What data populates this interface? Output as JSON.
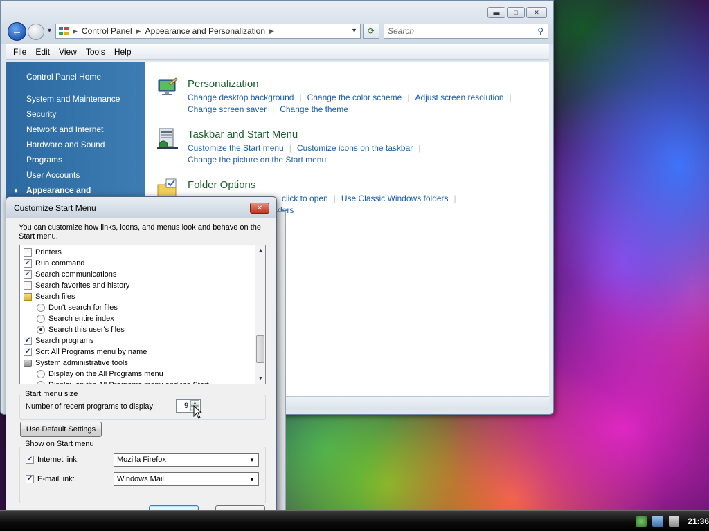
{
  "control_panel": {
    "address": [
      "Control Panel",
      "Appearance and Personalization"
    ],
    "search_placeholder": "Search",
    "menu": [
      "File",
      "Edit",
      "View",
      "Tools",
      "Help"
    ],
    "sidebar": {
      "home": "Control Panel Home",
      "items": [
        "System and Maintenance",
        "Security",
        "Network and Internet",
        "Hardware and Sound",
        "Programs",
        "User Accounts",
        "Appearance and"
      ]
    },
    "categories": [
      {
        "title": "Personalization",
        "links": [
          "Change desktop background",
          "Change the color scheme",
          "Adjust screen resolution"
        ],
        "links2": [
          "Change screen saver",
          "Change the theme"
        ]
      },
      {
        "title": "Taskbar and Start Menu",
        "links": [
          "Customize the Start menu",
          "Customize icons on the taskbar"
        ],
        "links2": [
          "Change the picture on the Start menu"
        ]
      },
      {
        "title": "Folder Options",
        "links": [
          "click to open",
          "Use Classic Windows folders"
        ],
        "links2": [
          "ders"
        ]
      }
    ]
  },
  "dialog": {
    "title": "Customize Start Menu",
    "description": "You can customize how links, icons, and menus look and behave on the Start menu.",
    "options": [
      {
        "label": "Printers",
        "kind": "checkbox",
        "checked": false,
        "sub": false
      },
      {
        "label": "Run command",
        "kind": "checkbox",
        "checked": true,
        "sub": false
      },
      {
        "label": "Search communications",
        "kind": "checkbox",
        "checked": true,
        "sub": false
      },
      {
        "label": "Search favorites and history",
        "kind": "checkbox",
        "checked": false,
        "sub": false
      },
      {
        "label": "Search files",
        "kind": "folder",
        "checked": false,
        "sub": false
      },
      {
        "label": "Don't search for files",
        "kind": "radio",
        "checked": false,
        "sub": true
      },
      {
        "label": "Search entire index",
        "kind": "radio",
        "checked": false,
        "sub": true
      },
      {
        "label": "Search this user's files",
        "kind": "radio",
        "checked": true,
        "sub": true
      },
      {
        "label": "Search programs",
        "kind": "checkbox",
        "checked": true,
        "sub": false
      },
      {
        "label": "Sort All Programs menu by name",
        "kind": "checkbox",
        "checked": true,
        "sub": false
      },
      {
        "label": "System administrative tools",
        "kind": "admin",
        "checked": false,
        "sub": false
      },
      {
        "label": "Display on the All Programs menu",
        "kind": "radio",
        "checked": false,
        "sub": true
      },
      {
        "label": "Display on the All Programs menu and the Start",
        "kind": "radio",
        "checked": true,
        "sub": true
      }
    ],
    "start_menu_size": {
      "group_label": "Start menu size",
      "recent_label": "Number of recent programs to display:",
      "recent_value": "9"
    },
    "default_button": "Use Default Settings",
    "show_on_start": {
      "group_label": "Show on Start menu",
      "internet_label": "Internet link:",
      "internet_value": "Mozilla Firefox",
      "email_label": "E-mail link:",
      "email_value": "Windows Mail"
    },
    "ok_label": "OK",
    "cancel_label": "Cancel"
  },
  "taskbar": {
    "clock": "21:36"
  },
  "icons": {
    "back": "back-arrow-icon",
    "forward": "forward-arrow-icon",
    "refresh": "refresh-icon",
    "search": "search-icon",
    "close": "close-icon"
  }
}
